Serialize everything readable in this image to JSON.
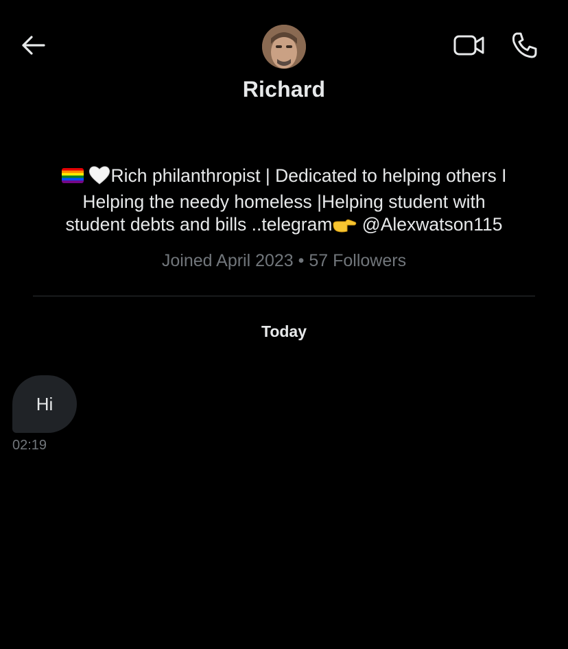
{
  "header": {
    "back_icon": "arrow-left-icon",
    "video_icon": "video-call-icon",
    "phone_icon": "phone-call-icon"
  },
  "profile": {
    "avatar_icon": "user-avatar-photo",
    "name": "Richard",
    "bio": {
      "emoji_1": "rainbow-flag-icon",
      "emoji_2": "white-heart-icon",
      "text_1": "Rich philanthropist | Dedicated to helping others I",
      "text_2": "Helping the needy homeless |Helping student with",
      "text_3": "student debts and bills ..telegram",
      "emoji_3": "pointing-hand-icon",
      "text_4": " @Alexwatson115"
    },
    "meta": "Joined April 2023 • 57 Followers"
  },
  "conversation": {
    "date_label": "Today",
    "messages": [
      {
        "text": "Hi",
        "time": "02:19",
        "direction": "incoming"
      }
    ]
  },
  "colors": {
    "background": "#000000",
    "primary_text": "#e7e9ea",
    "secondary_text": "#71767b",
    "divider": "#2f3336",
    "bubble": "#202327"
  }
}
